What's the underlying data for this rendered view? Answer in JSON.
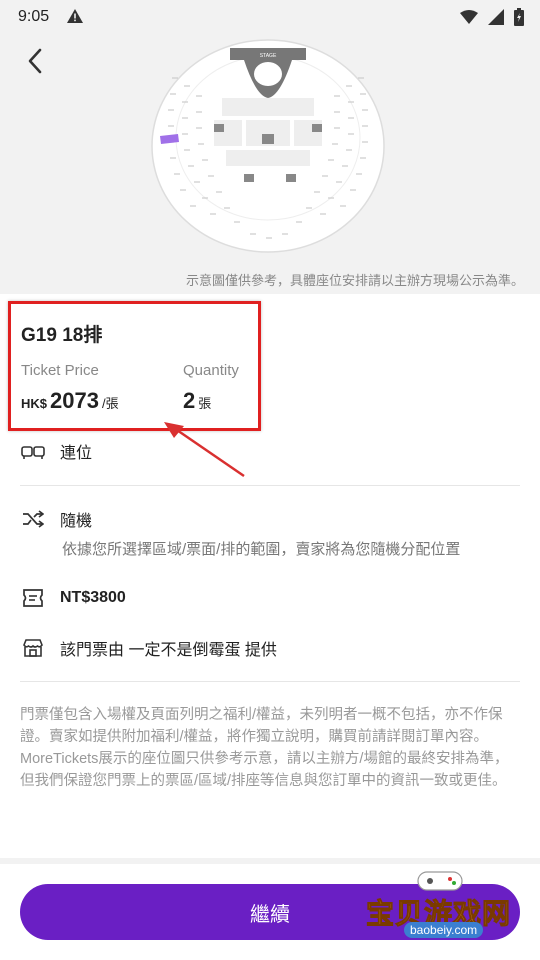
{
  "status_bar": {
    "time": "9:05"
  },
  "map": {
    "stage_label": "STAGE",
    "note": "示意圖僅供參考，具體座位安排請以主辦方現場公示為準。"
  },
  "ticket": {
    "seat": "G19 18排",
    "price_label": "Ticket Price",
    "quantity_label": "Quantity",
    "currency": "HK$",
    "price": "2073",
    "price_unit": "/張",
    "quantity": "2",
    "quantity_unit": "張"
  },
  "features": {
    "adjacent": "連位",
    "random_title": "隨機",
    "random_desc": "依據您所選擇區域/票面/排的範圍，賣家將為您隨機分配位置",
    "price_ntd": "NT$3800",
    "seller": "該門票由 一定不是倒霉蛋 提供"
  },
  "terms": {
    "p1": "門票僅包含入場權及頁面列明之福利/權益，未列明者一概不包括，亦不作保證。賣家如提供附加福利/權益，將作獨立說明，購買前請詳閱訂單內容。",
    "p2": "MoreTickets展示的座位圖只供參考示意，請以主辦方/場館的最終安排為準，但我們保證您門票上的票區/區域/排座等信息與您訂單中的資訊一致或更佳。"
  },
  "actions": {
    "continue": "繼續"
  },
  "watermark": {
    "text": "宝贝游戏网",
    "url": "baobeiy.com"
  },
  "colors": {
    "primary": "#6a1fc4",
    "highlight": "#e02020"
  },
  "icons": [
    "warning-icon",
    "wifi-icon",
    "signal-icon",
    "battery-icon",
    "back-arrow-icon",
    "sofa-icon",
    "shuffle-icon",
    "ticket-icon",
    "store-icon"
  ]
}
